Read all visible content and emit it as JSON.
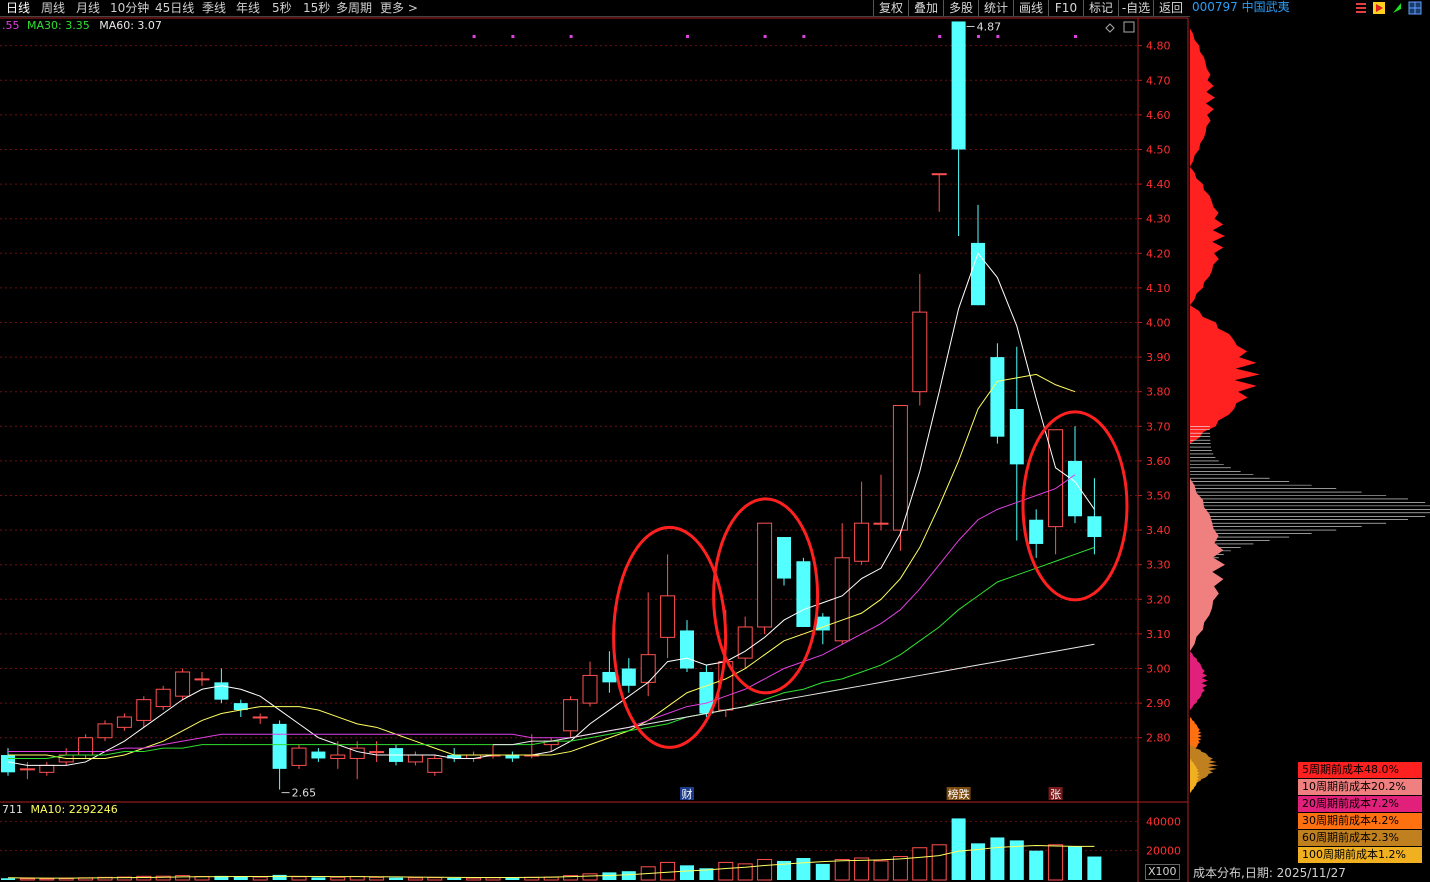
{
  "topbar": {
    "tabs": [
      "日线",
      "周线",
      "月线",
      "10分钟",
      "45日线",
      "季线",
      "年线",
      "5秒",
      "15秒",
      "多周期",
      "更多 >"
    ],
    "buttons": [
      "复权",
      "叠加",
      "多股",
      "统计",
      "画线",
      "F10",
      "标记",
      "-自选",
      "返回"
    ]
  },
  "stock": {
    "code_name": "000797 中国武夷"
  },
  "ma_labels": {
    "ma5": ".55",
    "ma30": "MA30: 3.35",
    "ma60": "MA60: 3.07"
  },
  "volume_labels": {
    "vol": "711",
    "ma10": "MA10: 2292246",
    "multiplier": "X100"
  },
  "annotations": {
    "high": "4.87",
    "low": "2.65",
    "markers": [
      "财",
      "榜跌",
      "张"
    ]
  },
  "cost_distribution": {
    "label": "成本分布,日期:  2025/11/27",
    "legend": [
      {
        "text": "5周期前成本48.0%",
        "color": "#ff2020"
      },
      {
        "text": "10周期前成本20.2%",
        "color": "#f08080"
      },
      {
        "text": "20周期前成本7.2%",
        "color": "#e0207a"
      },
      {
        "text": "30周期前成本4.2%",
        "color": "#ff7010"
      },
      {
        "text": "60周期前成本2.3%",
        "color": "#c08020"
      },
      {
        "text": "100周期前成本1.2%",
        "color": "#f0b020"
      }
    ]
  },
  "colors": {
    "up": "#ff5050",
    "down": "#54ffff",
    "ma5": "#ffffff",
    "ma10": "#ffff60",
    "ma20": "#e040e0",
    "ma30": "#30e030",
    "ma60": "#e8e8e8",
    "circle": "#ff2020"
  },
  "chart_data": {
    "type": "candlestick",
    "y_ticks": [
      "4.80",
      "4.70",
      "4.60",
      "4.50",
      "4.40",
      "4.30",
      "4.20",
      "4.10",
      "4.00",
      "3.90",
      "3.80",
      "3.70",
      "3.60",
      "3.50",
      "3.40",
      "3.30",
      "3.20",
      "3.10",
      "3.00",
      "2.90",
      "2.80"
    ],
    "ylim": [
      2.62,
      4.88
    ],
    "volume_ticks": [
      "40000",
      "20000"
    ],
    "volume_ylim": [
      0,
      45000
    ],
    "candles": [
      {
        "o": 2.75,
        "c": 2.7,
        "h": 2.77,
        "l": 2.69
      },
      {
        "o": 2.71,
        "c": 2.71,
        "h": 2.73,
        "l": 2.68
      },
      {
        "o": 2.7,
        "c": 2.72,
        "h": 2.73,
        "l": 2.69
      },
      {
        "o": 2.73,
        "c": 2.75,
        "h": 2.77,
        "l": 2.72
      },
      {
        "o": 2.75,
        "c": 2.8,
        "h": 2.81,
        "l": 2.74
      },
      {
        "o": 2.8,
        "c": 2.84,
        "h": 2.85,
        "l": 2.79
      },
      {
        "o": 2.83,
        "c": 2.86,
        "h": 2.87,
        "l": 2.82
      },
      {
        "o": 2.85,
        "c": 2.91,
        "h": 2.92,
        "l": 2.83
      },
      {
        "o": 2.89,
        "c": 2.94,
        "h": 2.95,
        "l": 2.88
      },
      {
        "o": 2.92,
        "c": 2.99,
        "h": 3.0,
        "l": 2.91
      },
      {
        "o": 2.97,
        "c": 2.97,
        "h": 2.99,
        "l": 2.95
      },
      {
        "o": 2.96,
        "c": 2.91,
        "h": 3.0,
        "l": 2.9
      },
      {
        "o": 2.9,
        "c": 2.88,
        "h": 2.91,
        "l": 2.86
      },
      {
        "o": 2.86,
        "c": 2.86,
        "h": 2.87,
        "l": 2.84
      },
      {
        "o": 2.84,
        "c": 2.71,
        "h": 2.85,
        "l": 2.65
      },
      {
        "o": 2.72,
        "c": 2.77,
        "h": 2.78,
        "l": 2.71
      },
      {
        "o": 2.76,
        "c": 2.74,
        "h": 2.77,
        "l": 2.73
      },
      {
        "o": 2.74,
        "c": 2.75,
        "h": 2.79,
        "l": 2.71
      },
      {
        "o": 2.74,
        "c": 2.77,
        "h": 2.79,
        "l": 2.68
      },
      {
        "o": 2.76,
        "c": 2.76,
        "h": 2.79,
        "l": 2.73
      },
      {
        "o": 2.77,
        "c": 2.73,
        "h": 2.78,
        "l": 2.72
      },
      {
        "o": 2.73,
        "c": 2.75,
        "h": 2.76,
        "l": 2.72
      },
      {
        "o": 2.7,
        "c": 2.74,
        "h": 2.75,
        "l": 2.69
      },
      {
        "o": 2.75,
        "c": 2.74,
        "h": 2.77,
        "l": 2.73
      },
      {
        "o": 2.74,
        "c": 2.75,
        "h": 2.76,
        "l": 2.73
      },
      {
        "o": 2.75,
        "c": 2.75,
        "h": 2.78,
        "l": 2.74
      },
      {
        "o": 2.75,
        "c": 2.74,
        "h": 2.76,
        "l": 2.73
      },
      {
        "o": 2.75,
        "c": 2.75,
        "h": 2.81,
        "l": 2.74
      },
      {
        "o": 2.78,
        "c": 2.79,
        "h": 2.8,
        "l": 2.76
      },
      {
        "o": 2.82,
        "c": 2.91,
        "h": 2.92,
        "l": 2.8
      },
      {
        "o": 2.9,
        "c": 2.98,
        "h": 3.02,
        "l": 2.89
      },
      {
        "o": 2.99,
        "c": 2.96,
        "h": 3.05,
        "l": 2.93
      },
      {
        "o": 3.0,
        "c": 2.95,
        "h": 3.03,
        "l": 2.93
      },
      {
        "o": 2.96,
        "c": 3.04,
        "h": 3.22,
        "l": 2.92
      },
      {
        "o": 3.09,
        "c": 3.21,
        "h": 3.33,
        "l": 3.03
      },
      {
        "o": 3.11,
        "c": 3.0,
        "h": 3.14,
        "l": 2.99
      },
      {
        "o": 2.99,
        "c": 2.87,
        "h": 3.01,
        "l": 2.86
      },
      {
        "o": 2.88,
        "c": 3.02,
        "h": 3.17,
        "l": 2.86
      },
      {
        "o": 3.03,
        "c": 3.12,
        "h": 3.15,
        "l": 3.0
      },
      {
        "o": 3.12,
        "c": 3.42,
        "h": 3.42,
        "l": 3.1
      },
      {
        "o": 3.38,
        "c": 3.26,
        "h": 3.38,
        "l": 3.24
      },
      {
        "o": 3.31,
        "c": 3.12,
        "h": 3.32,
        "l": 3.12
      },
      {
        "o": 3.15,
        "c": 3.11,
        "h": 3.16,
        "l": 3.07
      },
      {
        "o": 3.08,
        "c": 3.32,
        "h": 3.42,
        "l": 3.07
      },
      {
        "o": 3.31,
        "c": 3.42,
        "h": 3.54,
        "l": 3.3
      },
      {
        "o": 3.42,
        "c": 3.42,
        "h": 3.56,
        "l": 3.4
      },
      {
        "o": 3.4,
        "c": 3.76,
        "h": 3.76,
        "l": 3.34
      },
      {
        "o": 3.8,
        "c": 4.03,
        "h": 4.14,
        "l": 3.76
      },
      {
        "o": 4.43,
        "c": 4.43,
        "h": 4.43,
        "l": 4.32
      },
      {
        "o": 4.87,
        "c": 4.5,
        "h": 4.87,
        "l": 4.25
      },
      {
        "o": 4.23,
        "c": 4.05,
        "h": 4.34,
        "l": 4.05
      },
      {
        "o": 3.9,
        "c": 3.67,
        "h": 3.94,
        "l": 3.65
      },
      {
        "o": 3.75,
        "c": 3.59,
        "h": 3.93,
        "l": 3.37
      },
      {
        "o": 3.43,
        "c": 3.36,
        "h": 3.46,
        "l": 3.32
      },
      {
        "o": 3.41,
        "c": 3.69,
        "h": 3.69,
        "l": 3.33
      },
      {
        "o": 3.6,
        "c": 3.44,
        "h": 3.7,
        "l": 3.42
      },
      {
        "o": 3.44,
        "c": 3.38,
        "h": 3.55,
        "l": 3.33
      }
    ],
    "ma5": [
      2.73,
      2.72,
      2.72,
      2.72,
      2.73,
      2.76,
      2.79,
      2.83,
      2.87,
      2.91,
      2.94,
      2.95,
      2.94,
      2.92,
      2.88,
      2.84,
      2.8,
      2.78,
      2.76,
      2.75,
      2.75,
      2.75,
      2.75,
      2.74,
      2.74,
      2.75,
      2.75,
      2.75,
      2.76,
      2.79,
      2.84,
      2.88,
      2.92,
      2.96,
      3.02,
      3.03,
      3.01,
      3.02,
      3.05,
      3.09,
      3.14,
      3.17,
      3.19,
      3.21,
      3.26,
      3.29,
      3.39,
      3.57,
      3.8,
      4.04,
      4.2,
      4.13,
      3.99,
      3.78,
      3.58,
      3.54,
      3.46
    ],
    "ma10": [
      2.75,
      2.75,
      2.75,
      2.74,
      2.74,
      2.74,
      2.75,
      2.77,
      2.79,
      2.82,
      2.85,
      2.87,
      2.88,
      2.89,
      2.89,
      2.89,
      2.88,
      2.86,
      2.84,
      2.83,
      2.81,
      2.79,
      2.77,
      2.75,
      2.75,
      2.75,
      2.75,
      2.75,
      2.75,
      2.76,
      2.78,
      2.8,
      2.82,
      2.85,
      2.89,
      2.93,
      2.95,
      2.97,
      3.0,
      3.04,
      3.08,
      3.1,
      3.12,
      3.14,
      3.16,
      3.2,
      3.26,
      3.35,
      3.47,
      3.6,
      3.75,
      3.83,
      3.84,
      3.85,
      3.82,
      3.8
    ],
    "ma20": [
      2.76,
      2.76,
      2.76,
      2.76,
      2.76,
      2.76,
      2.77,
      2.77,
      2.78,
      2.79,
      2.8,
      2.81,
      2.81,
      2.81,
      2.81,
      2.81,
      2.81,
      2.81,
      2.81,
      2.81,
      2.81,
      2.81,
      2.81,
      2.81,
      2.81,
      2.81,
      2.81,
      2.8,
      2.8,
      2.8,
      2.81,
      2.82,
      2.83,
      2.85,
      2.87,
      2.89,
      2.9,
      2.92,
      2.94,
      2.97,
      3.0,
      3.02,
      3.04,
      3.07,
      3.1,
      3.13,
      3.17,
      3.23,
      3.3,
      3.37,
      3.43,
      3.46,
      3.48,
      3.5,
      3.52,
      3.56
    ],
    "ma30": [
      2.74,
      2.74,
      2.74,
      2.75,
      2.75,
      2.75,
      2.76,
      2.76,
      2.77,
      2.77,
      2.78,
      2.78,
      2.78,
      2.78,
      2.78,
      2.78,
      2.78,
      2.78,
      2.78,
      2.78,
      2.78,
      2.78,
      2.78,
      2.78,
      2.78,
      2.78,
      2.78,
      2.78,
      2.79,
      2.79,
      2.8,
      2.81,
      2.82,
      2.83,
      2.84,
      2.86,
      2.87,
      2.88,
      2.89,
      2.91,
      2.93,
      2.94,
      2.96,
      2.97,
      2.99,
      3.01,
      3.04,
      3.08,
      3.12,
      3.17,
      3.21,
      3.25,
      3.27,
      3.29,
      3.31,
      3.33,
      3.35
    ],
    "ma60": [
      2.78,
      2.78,
      2.79,
      2.79,
      2.8,
      2.81,
      2.82,
      2.83,
      2.84,
      2.85,
      2.86,
      2.87,
      2.88,
      2.89,
      2.9,
      2.91,
      2.92,
      2.93,
      2.94,
      2.95,
      2.96,
      2.97,
      2.98,
      2.99,
      3.0,
      3.01,
      3.02,
      3.03,
      3.04,
      3.05,
      3.06,
      3.07
    ],
    "volume": [
      1200,
      900,
      800,
      1000,
      1500,
      1800,
      2000,
      2500,
      2600,
      3000,
      2400,
      2800,
      2600,
      2000,
      3500,
      2200,
      1800,
      1900,
      2400,
      1800,
      1600,
      1500,
      1600,
      1400,
      1300,
      1500,
      1400,
      1800,
      1900,
      3000,
      4200,
      5200,
      6000,
      9000,
      12000,
      10000,
      8000,
      12000,
      11000,
      14000,
      13000,
      15000,
      11000,
      14000,
      15000,
      13000,
      16000,
      22000,
      24000,
      42000,
      25000,
      29000,
      27000,
      20000,
      24000,
      23000,
      16000
    ],
    "volume_ma10": [
      1500,
      1400,
      1300,
      1300,
      1400,
      1500,
      1600,
      1700,
      1900,
      2100,
      2200,
      2300,
      2400,
      2400,
      2500,
      2500,
      2400,
      2300,
      2300,
      2200,
      2100,
      2000,
      1900,
      1800,
      1700,
      1700,
      1700,
      1800,
      2000,
      2300,
      2700,
      3100,
      3600,
      4400,
      5300,
      6100,
      6800,
      7800,
      8700,
      9900,
      10800,
      11800,
      12500,
      13100,
      13400,
      13700,
      14400,
      15400,
      16600,
      19700,
      20800,
      22200,
      22900,
      23500,
      23200,
      22900,
      22922
    ]
  }
}
